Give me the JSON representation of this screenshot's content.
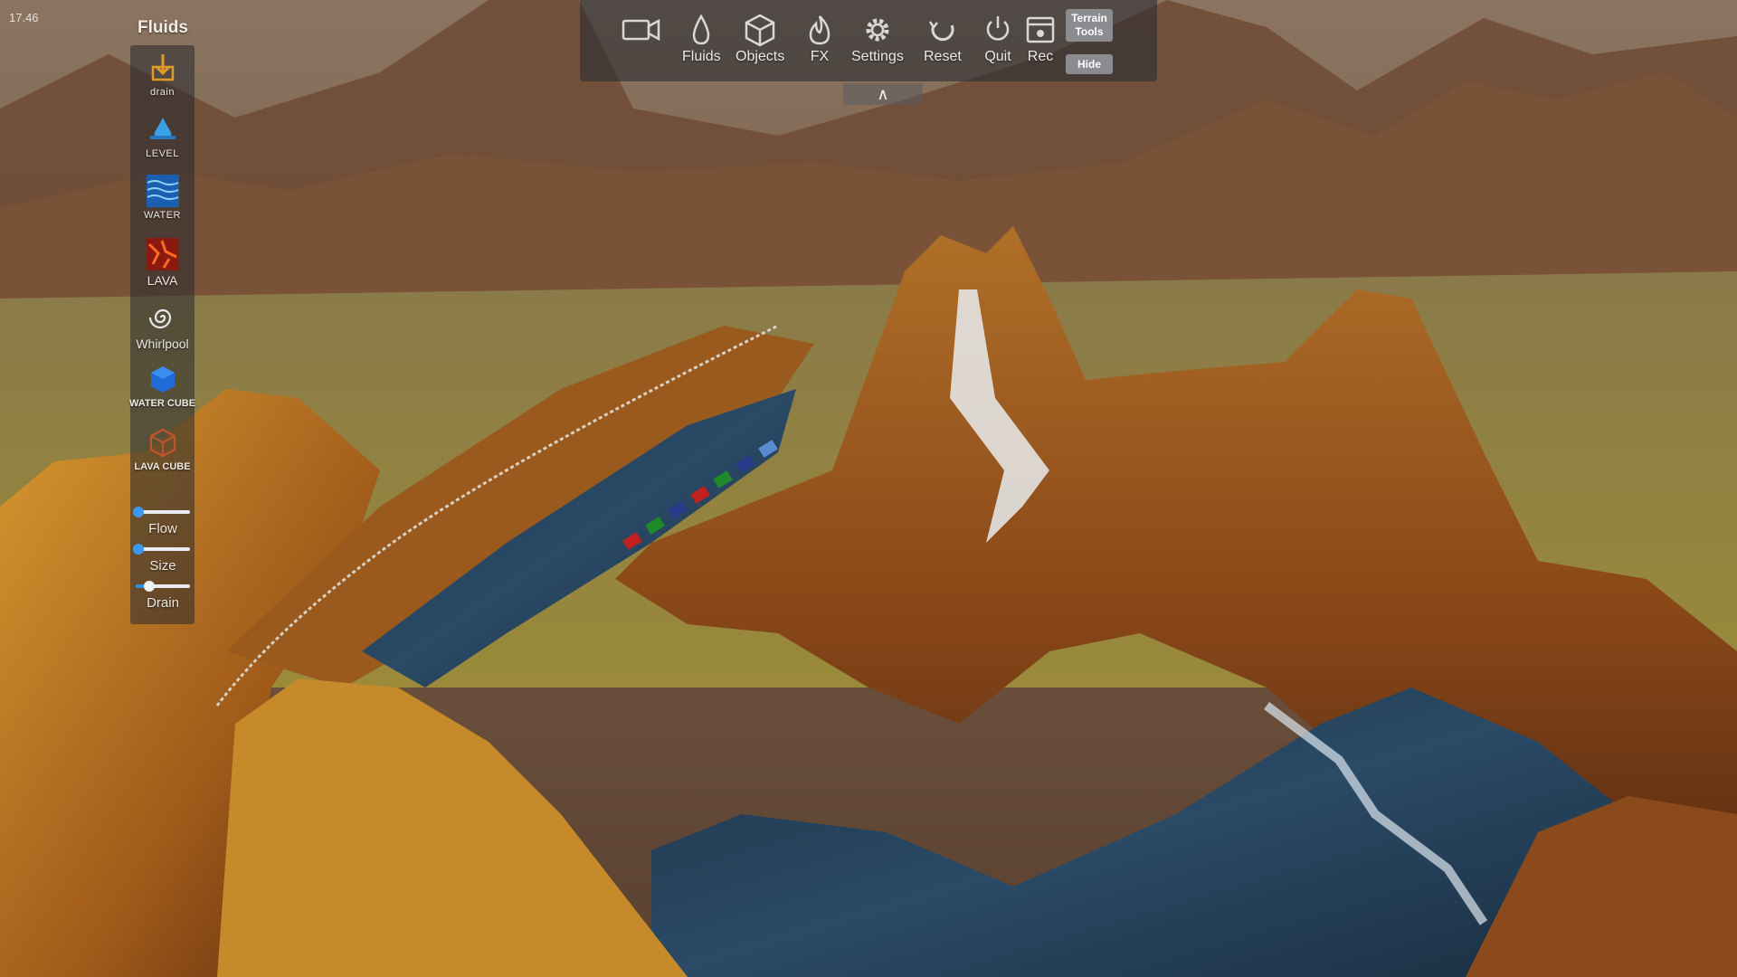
{
  "hud": {
    "fps": "17.46"
  },
  "fluids_panel": {
    "title": "Fluids",
    "tools": [
      {
        "label": "drain",
        "icon": "drain-icon"
      },
      {
        "label": "LEVEL",
        "icon": "level-icon"
      },
      {
        "label": "WATER",
        "icon": "water-icon"
      },
      {
        "label": "LAVA",
        "icon": "lava-icon"
      },
      {
        "label": "Whirlpool",
        "icon": "whirlpool-icon"
      },
      {
        "label": "WATER CUBE",
        "icon": "water-cube-icon"
      },
      {
        "label": "LAVA CUBE",
        "icon": "lava-cube-icon"
      }
    ],
    "sliders": [
      {
        "label": "Flow",
        "value": 0.05
      },
      {
        "label": "Size",
        "value": 0.05
      },
      {
        "label": "Drain",
        "value": 0.25
      }
    ]
  },
  "toolbar": {
    "items": [
      {
        "label": "",
        "icon": "camera-icon"
      },
      {
        "label": "Fluids",
        "icon": "droplet-icon"
      },
      {
        "label": "Objects",
        "icon": "cube-icon"
      },
      {
        "label": "FX",
        "icon": "fire-icon"
      },
      {
        "label": "Settings",
        "icon": "gear-icon"
      },
      {
        "label": "Reset",
        "icon": "reset-icon"
      },
      {
        "label": "Quit",
        "icon": "power-icon"
      },
      {
        "label": "Rec",
        "icon": "record-icon"
      }
    ],
    "terrain_tools": "Terrain Tools",
    "hide": "Hide",
    "collapse": "∧"
  },
  "colors": {
    "water": "#1d3a52",
    "rock": "#8a4a1c",
    "grass": "#7d8a3a",
    "accent": "#2f8ee6"
  }
}
